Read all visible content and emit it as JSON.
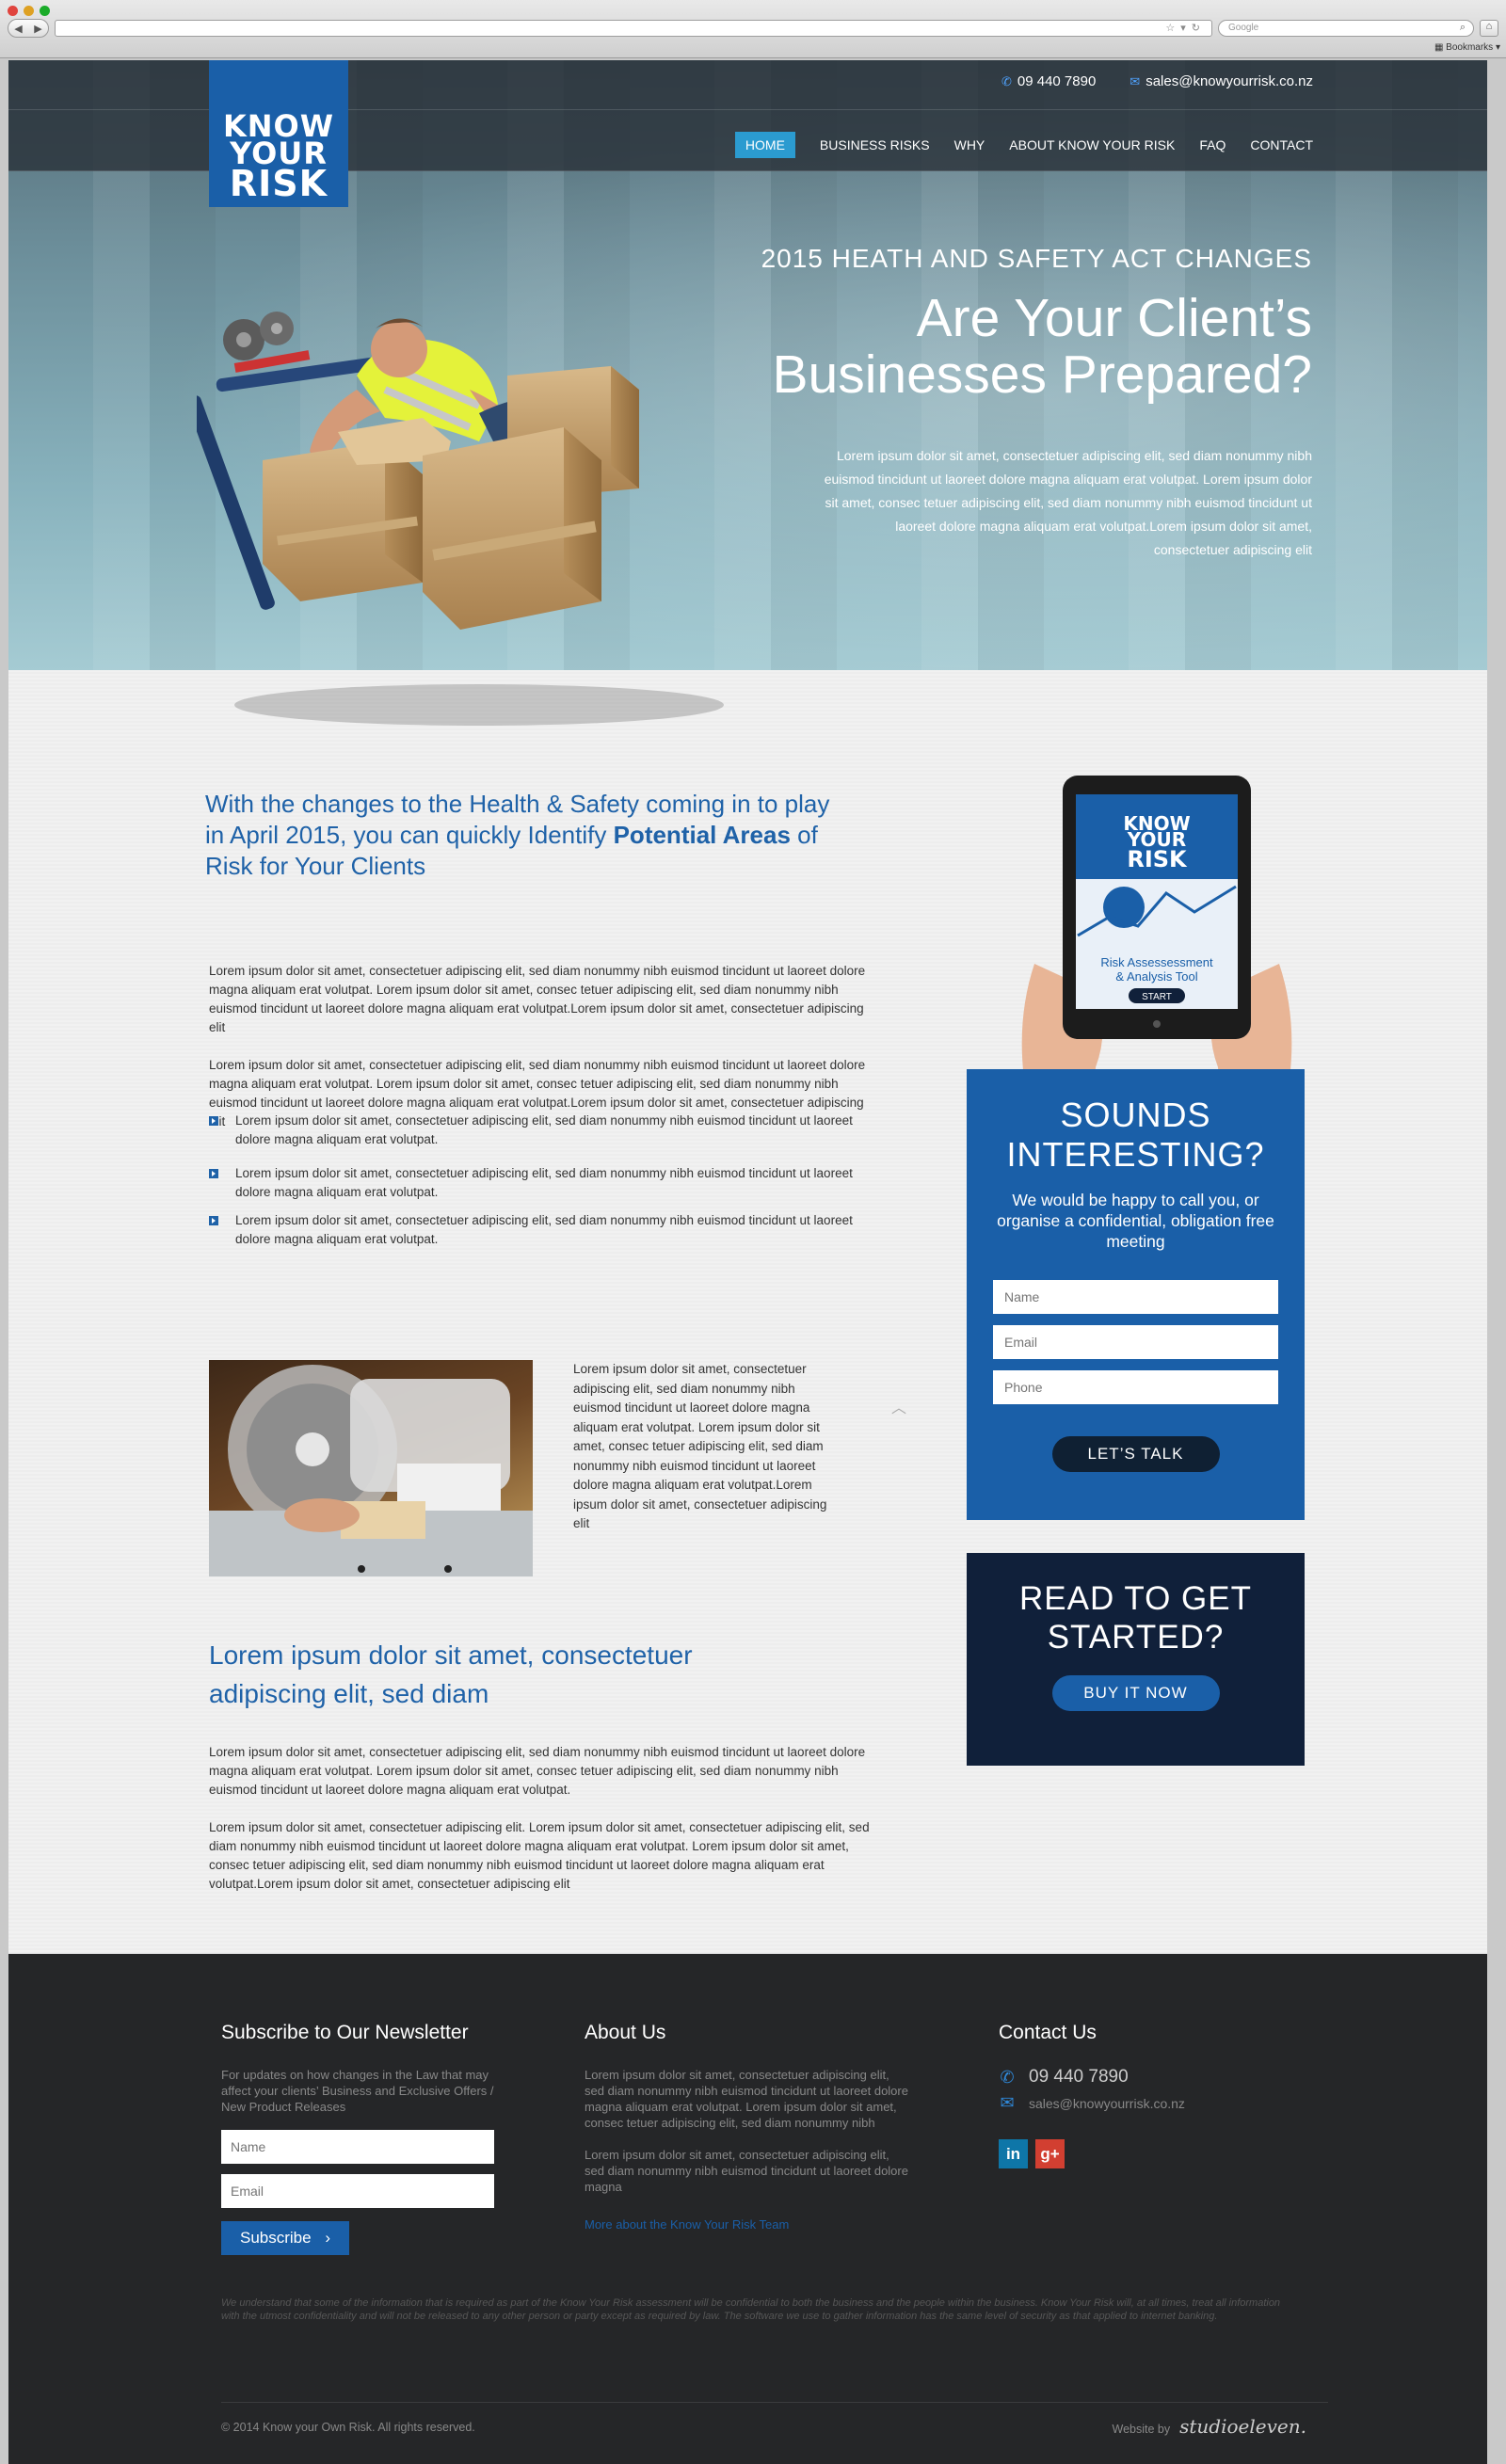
{
  "browser": {
    "search_placeholder": "Google",
    "bookmarks_label": "Bookmarks"
  },
  "header": {
    "logo_lines": [
      "KNOW",
      "YOUR",
      "RISK"
    ],
    "phone": "09 440 7890",
    "email": "sales@knowyourrisk.co.nz",
    "nav": [
      "HOME",
      "BUSINESS RISKS",
      "WHY",
      "ABOUT KNOW YOUR RISK",
      "FAQ",
      "CONTACT"
    ],
    "active_nav": "HOME"
  },
  "hero": {
    "subtitle": "2015 HEATH AND SAFETY ACT CHANGES",
    "title": "Are Your Client’s Businesses Prepared?",
    "copy": "Lorem ipsum dolor sit amet, consectetuer adipiscing elit, sed diam nonummy nibh euismod tincidunt ut laoreet dolore magna aliquam erat volutpat. Lorem ipsum dolor sit amet, consec tetuer adipiscing elit, sed diam nonummy nibh euismod tincidunt ut laoreet dolore magna aliquam erat volutpat.Lorem ipsum dolor sit amet, consectetuer adipiscing elit"
  },
  "intro": {
    "title_part1": "With the changes to the Health & Safety coming in to play in April 2015, you can quickly Identify ",
    "title_bold": "Potential Areas",
    "title_part2": " of Risk for Your Clients",
    "paragraphs": [
      "Lorem ipsum dolor sit amet, consectetuer adipiscing elit, sed diam nonummy nibh euismod tincidunt ut laoreet dolore magna aliquam erat volutpat. Lorem ipsum dolor sit amet, consec tetuer adipiscing elit, sed diam nonummy nibh euismod tincidunt ut laoreet dolore magna aliquam erat volutpat.Lorem ipsum dolor sit amet, consectetuer adipiscing elit",
      "Lorem ipsum dolor sit amet, consectetuer adipiscing elit, sed diam nonummy nibh euismod tincidunt ut laoreet dolore magna aliquam erat volutpat. Lorem ipsum dolor sit amet, consec tetuer adipiscing elit, sed diam nonummy nibh euismod tincidunt ut laoreet dolore magna aliquam erat volutpat.Lorem ipsum dolor sit amet, consectetuer adipiscing elit"
    ],
    "bullets": [
      "Lorem ipsum dolor sit amet, consectetuer adipiscing elit, sed diam nonummy nibh euismod tincidunt ut laoreet dolore magna aliquam erat volutpat.",
      "Lorem ipsum dolor sit amet, consectetuer adipiscing elit, sed diam nonummy nibh euismod tincidunt ut laoreet dolore magna aliquam erat volutpat.",
      "Lorem ipsum dolor sit amet, consectetuer adipiscing elit, sed diam nonummy nibh euismod tincidunt ut laoreet dolore magna aliquam erat volutpat."
    ],
    "image_caption": "Lorem ipsum dolor sit amet, consectetuer adipiscing elit, sed diam nonummy nibh euismod tincidunt ut laoreet dolore magna aliquam erat volutpat. Lorem ipsum dolor sit amet, consec tetuer adipiscing elit, sed diam nonummy nibh euismod tincidunt ut laoreet dolore magna aliquam erat volutpat.Lorem ipsum dolor sit amet, consectetuer adipiscing elit"
  },
  "section2": {
    "title": "Lorem ipsum dolor sit amet, consectetuer adipiscing elit, sed diam",
    "paragraphs": [
      "Lorem ipsum dolor sit amet, consectetuer adipiscing elit, sed diam nonummy nibh euismod tincidunt ut laoreet dolore magna aliquam erat volutpat. Lorem ipsum dolor sit amet, consec tetuer adipiscing elit, sed diam nonummy nibh euismod tincidunt ut laoreet dolore magna aliquam erat volutpat.",
      "Lorem ipsum dolor sit amet, consectetuer adipiscing elit.  Lorem ipsum dolor sit amet, consectetuer adipiscing elit, sed diam nonummy nibh euismod tincidunt ut laoreet dolore magna aliquam erat volutpat. Lorem ipsum dolor sit amet, consec tetuer adipiscing elit, sed diam nonummy nibh euismod tincidunt ut laoreet dolore magna aliquam erat volutpat.Lorem ipsum dolor sit amet, consectetuer adipiscing elit"
    ]
  },
  "tablet": {
    "logo_lines": [
      "KNOW",
      "YOUR",
      "RISK"
    ],
    "caption": "Risk Assessessment & Analysis Tool",
    "start": "START"
  },
  "cta": {
    "title": "SOUNDS INTERESTING?",
    "text": "We would be happy to call you, or organise a confidential, obligation free meeting",
    "name_placeholder": "Name",
    "email_placeholder": "Email",
    "phone_placeholder": "Phone",
    "button": "LET’S TALK"
  },
  "cta2": {
    "title": "READ TO GET STARTED?",
    "button": "BUY IT NOW"
  },
  "footer": {
    "newsletter_title": "Subscribe to Our Newsletter",
    "newsletter_text": "For updates on how changes in the Law that may affect your clients’ Business and Exclusive Offers / New Product Releases",
    "name_placeholder": "Name",
    "email_placeholder": "Email",
    "subscribe": "Subscribe",
    "about_title": "About Us",
    "about_p1": "Lorem ipsum dolor sit amet, consectetuer adipiscing elit, sed diam nonummy nibh euismod tincidunt ut laoreet dolore magna aliquam erat volutpat. Lorem ipsum dolor sit amet, consec tetuer adipiscing elit, sed diam nonummy nibh",
    "about_p2": "Lorem ipsum dolor sit amet, consectetuer adipiscing elit, sed diam nonummy nibh euismod tincidunt ut laoreet dolore magna",
    "about_link": "More about the Know Your Risk Team",
    "contact_title": "Contact Us",
    "phone": "09 440 7890",
    "email": "sales@knowyourrisk.co.nz",
    "disclaimer": "We understand that some of the information that is required as part of the Know Your Risk  assessment will be confidential to both the business and the people within the business.  Know  Your Risk will, at all times, treat all information with the utmost confidentiality and will not be  released to any other person or party except as required by law.  The software we use to gather  information has the same level of security as that applied to internet banking.",
    "copyright": "© 2014  Know your Own Risk. All rights reserved.",
    "credit_label": "Website by",
    "credit_name": "studioeleven."
  },
  "colors": {
    "brand_blue": "#1a5fa8",
    "nav_active": "#2b9bd0",
    "dark_navy": "#10203a",
    "footer_bg": "#252628",
    "linkedin": "#0e76a8",
    "google_plus": "#d23f31"
  }
}
